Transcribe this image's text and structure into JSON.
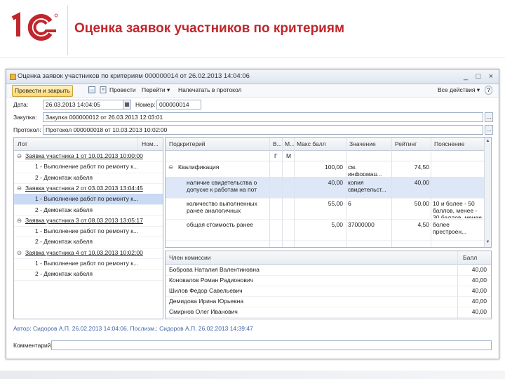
{
  "slide": {
    "title": "Оценка заявок участников по критериям",
    "logo_text": "1С",
    "brand_color": "#c0262c"
  },
  "window": {
    "title": "Оценка заявок участников по критериям 000000014 от 26.02.2013 14:04:06",
    "controls": [
      "_",
      "□",
      "×"
    ]
  },
  "toolbar": {
    "post_close": "Провести и закрыть",
    "post": "Провести",
    "goto": "Перейти ▾",
    "print": "Напечатать в протокол",
    "all_actions": "Все действия ▾",
    "help": "?"
  },
  "form": {
    "date_label": "Дата:",
    "date_value": "26.03.2013 14:04:05",
    "number_label": "Номер:",
    "number_value": "000000014",
    "purchase_label": "Закупка:",
    "purchase_value": "Закупка 000000012 от 26.03.2013 12:03:01",
    "protocol_label": "Протокол:",
    "protocol_value": "Протокол 000000018 от 10.03.2013 10:02:00"
  },
  "lots": {
    "headers": [
      "Лот",
      "Ном..."
    ],
    "rows": [
      {
        "text": "Заявка участника 1 от 10.01.2013 10:00:00",
        "level": 0,
        "icon": "⊖"
      },
      {
        "text": "1 - Выполнение работ по ремонту к...",
        "level": 1,
        "icon": ""
      },
      {
        "text": "2 - Демонтаж кабеля",
        "level": 1,
        "icon": ""
      },
      {
        "text": "Заявка участника 2 от 03.03.2013 13:04:45",
        "level": 0,
        "icon": "⊖"
      },
      {
        "text": "1 - Выполнение работ по ремонту к...",
        "level": 1,
        "icon": "",
        "selected": true
      },
      {
        "text": "2 - Демонтаж кабеля",
        "level": 1,
        "icon": ""
      },
      {
        "text": "Заявка участника 3 от 08.03.2013 13:05:17",
        "level": 0,
        "icon": "⊖"
      },
      {
        "text": "1 - Выполнение работ по ремонту к...",
        "level": 1,
        "icon": ""
      },
      {
        "text": "2 - Демонтаж кабеля",
        "level": 1,
        "icon": ""
      },
      {
        "text": "Заявка участника 4 от 10.03.2013 10:02:00",
        "level": 0,
        "icon": "⊖"
      },
      {
        "text": "1 - Выполнение работ по ремонту к...",
        "level": 1,
        "icon": ""
      },
      {
        "text": "2 - Демонтаж кабеля",
        "level": 1,
        "icon": ""
      }
    ]
  },
  "criteria": {
    "headers": [
      "Подкритерий",
      "В...",
      "М...",
      "Макс балл",
      "Значение",
      "Рейтинг",
      "Пояснение"
    ],
    "subheaders": [
      "",
      "Г",
      "М"
    ],
    "rows": [
      {
        "name": "Квалификация",
        "max": "100,00",
        "value": "см. информац...",
        "rating": "74,50",
        "note": "",
        "group": true
      },
      {
        "name": "наличие свидетельства о допуске к работам на пот",
        "max": "40,00",
        "value": "копия свидетельст...",
        "rating": "40,00",
        "note": "",
        "selected": true
      },
      {
        "name": "количество выполненных ранее аналогичных",
        "max": "55,00",
        "value": "6",
        "rating": "50,00",
        "note": "10 и более - 50 баллов, менее - 30 баллов, менее"
      },
      {
        "name": "общая стоимость ранее",
        "max": "5,00",
        "value": "37000000",
        "rating": "4,50",
        "note": "более престроен..."
      }
    ]
  },
  "commission": {
    "headers": [
      "Член комиссии",
      "Балл"
    ],
    "rows": [
      {
        "name": "Боброва Наталия Валентиновна",
        "score": "40,00"
      },
      {
        "name": "Коновалов Роман Радионович",
        "score": "40,00"
      },
      {
        "name": "Шилов Федор Савельевич",
        "score": "40,00"
      },
      {
        "name": "Демидова Ирина Юрьевна",
        "score": "40,00"
      },
      {
        "name": "Смирнов Олег Иванович",
        "score": "40,00"
      }
    ]
  },
  "footer": {
    "author_line": "Автор: Сидоров А.П. 26.02.2013 14:04:06, Послизм.: Сидоров А.П. 26.02.2013 14:39:47",
    "comment_label": "Комментарий:"
  }
}
